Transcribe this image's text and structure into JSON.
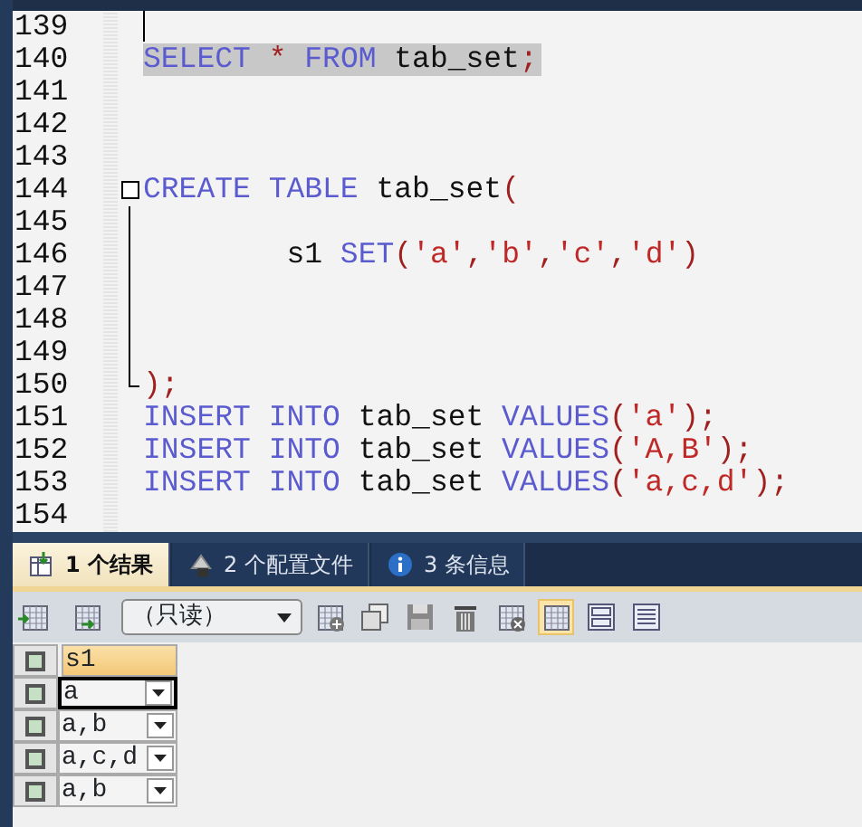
{
  "editor": {
    "lines": [
      {
        "number": "139",
        "caret": true
      },
      {
        "number": "140",
        "highlighted": true,
        "tokens": [
          {
            "text": "SELECT",
            "kind": "kw"
          },
          {
            "text": " *",
            "kind": "op"
          },
          {
            "text": " FROM",
            "kind": "kw"
          },
          {
            "text": " tab_set"
          },
          {
            "text": ";",
            "kind": "op"
          }
        ]
      },
      {
        "number": "141"
      },
      {
        "number": "142"
      },
      {
        "number": "143"
      },
      {
        "number": "144",
        "fold_start": true,
        "tokens": [
          {
            "text": "CREATE",
            "kind": "kw"
          },
          {
            "text": " TABLE",
            "kind": "kw"
          },
          {
            "text": " tab_set"
          },
          {
            "text": "(",
            "kind": "op"
          }
        ]
      },
      {
        "number": "145",
        "fold_body": true
      },
      {
        "number": "146",
        "fold_body": true,
        "tokens": [
          {
            "text": "        s1"
          },
          {
            "text": " SET",
            "kind": "kw"
          },
          {
            "text": "(",
            "kind": "op"
          },
          {
            "text": "'a'",
            "kind": "str"
          },
          {
            "text": ",",
            "kind": "op"
          },
          {
            "text": "'b'",
            "kind": "str"
          },
          {
            "text": ",",
            "kind": "op"
          },
          {
            "text": "'c'",
            "kind": "str"
          },
          {
            "text": ",",
            "kind": "op"
          },
          {
            "text": "'d'",
            "kind": "str"
          },
          {
            "text": ")",
            "kind": "op"
          }
        ]
      },
      {
        "number": "147",
        "fold_body": true
      },
      {
        "number": "148",
        "fold_body": true
      },
      {
        "number": "149",
        "fold_body": true
      },
      {
        "number": "150",
        "fold_end": true,
        "tokens": [
          {
            "text": ");",
            "kind": "op"
          }
        ]
      },
      {
        "number": "151",
        "tokens": [
          {
            "text": "INSERT",
            "kind": "kw"
          },
          {
            "text": " INTO",
            "kind": "kw"
          },
          {
            "text": " tab_set"
          },
          {
            "text": " VALUES",
            "kind": "kw"
          },
          {
            "text": "(",
            "kind": "op"
          },
          {
            "text": "'a'",
            "kind": "str"
          },
          {
            "text": ");",
            "kind": "op"
          }
        ]
      },
      {
        "number": "152",
        "tokens": [
          {
            "text": "INSERT",
            "kind": "kw"
          },
          {
            "text": " INTO",
            "kind": "kw"
          },
          {
            "text": " tab_set"
          },
          {
            "text": " VALUES",
            "kind": "kw"
          },
          {
            "text": "(",
            "kind": "op"
          },
          {
            "text": "'A,B'",
            "kind": "str"
          },
          {
            "text": ");",
            "kind": "op"
          }
        ]
      },
      {
        "number": "153",
        "tokens": [
          {
            "text": "INSERT",
            "kind": "kw"
          },
          {
            "text": " INTO",
            "kind": "kw"
          },
          {
            "text": " tab_set"
          },
          {
            "text": " VALUES",
            "kind": "kw"
          },
          {
            "text": "(",
            "kind": "op"
          },
          {
            "text": "'a,c,d'",
            "kind": "str"
          },
          {
            "text": ");",
            "kind": "op"
          }
        ]
      },
      {
        "number": "154"
      }
    ]
  },
  "results": {
    "tabs": [
      {
        "label": "1 个结果",
        "kind": "result",
        "selected": true
      },
      {
        "label": "2 个配置文件",
        "kind": "profile",
        "selected": false
      },
      {
        "label": "3 条信息",
        "kind": "info",
        "selected": false
      }
    ],
    "mode_select": {
      "value": "（只读）"
    },
    "grid": {
      "column": "s1",
      "rows": [
        {
          "value": "a",
          "selected": true
        },
        {
          "value": "a,b",
          "selected": false
        },
        {
          "value": "a,c,d",
          "selected": false
        },
        {
          "value": "a,b",
          "selected": false
        }
      ]
    }
  }
}
